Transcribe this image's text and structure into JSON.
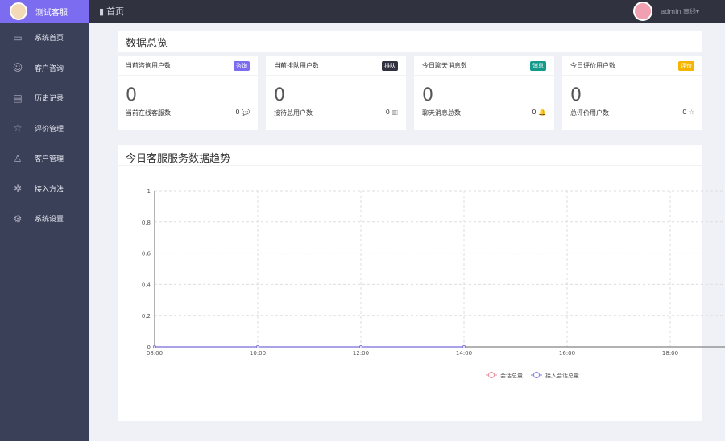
{
  "brand": {
    "name": "测试客服"
  },
  "sidebar": {
    "items": [
      {
        "label": "系统首页",
        "icon": "window-icon"
      },
      {
        "label": "客户咨询",
        "icon": "smile-icon"
      },
      {
        "label": "历史记录",
        "icon": "record-icon"
      },
      {
        "label": "评价管理",
        "icon": "star-icon"
      },
      {
        "label": "客户管理",
        "icon": "user-icon"
      },
      {
        "label": "接入方法",
        "icon": "puzzle-icon"
      },
      {
        "label": "系统设置",
        "icon": "gear-icon"
      }
    ]
  },
  "header": {
    "breadcrumb": "首页",
    "user": "admin",
    "status": "离线▾"
  },
  "overview": {
    "title": "数据总览",
    "cards": [
      {
        "title": "当前咨询用户数",
        "badge": "咨询",
        "badge_color": "#7b6cf0",
        "value": "0",
        "sub": "当前在线客服数",
        "sub_value": "0",
        "icon": "chat-icon",
        "glyph": "💬"
      },
      {
        "title": "当前排队用户数",
        "badge": "排队",
        "badge_color": "#2f3140",
        "value": "0",
        "sub": "接待总用户数",
        "sub_value": "0",
        "icon": "queue-icon",
        "glyph": "▥"
      },
      {
        "title": "今日聊天消息数",
        "badge": "消息",
        "badge_color": "#15998a",
        "value": "0",
        "sub": "聊天消息总数",
        "sub_value": "0",
        "icon": "bell-icon",
        "glyph": "🔔"
      },
      {
        "title": "今日评价用户数",
        "badge": "评价",
        "badge_color": "#f5b400",
        "value": "0",
        "sub": "总评价用户数",
        "sub_value": "0",
        "icon": "star-icon",
        "glyph": "☆"
      }
    ]
  },
  "trend": {
    "title": "今日客服服务数据趋势"
  },
  "chart_data": {
    "type": "line",
    "x": [
      "08:00",
      "10:00",
      "12:00",
      "14:00"
    ],
    "xticks": [
      "08:00",
      "10:00",
      "12:00",
      "14:00",
      "16:00",
      "18:00"
    ],
    "yticks": [
      "0",
      "0.2",
      "0.4",
      "0.6",
      "0.8",
      "1"
    ],
    "ylim": [
      0,
      1
    ],
    "grid": true,
    "legend": "bottom-center",
    "series": [
      {
        "name": "会话总量",
        "color": "#e88b9a",
        "values": [
          0,
          0,
          0,
          0
        ]
      },
      {
        "name": "接入会话总量",
        "color": "#7b7be8",
        "values": [
          0,
          0,
          0,
          0
        ]
      }
    ]
  }
}
